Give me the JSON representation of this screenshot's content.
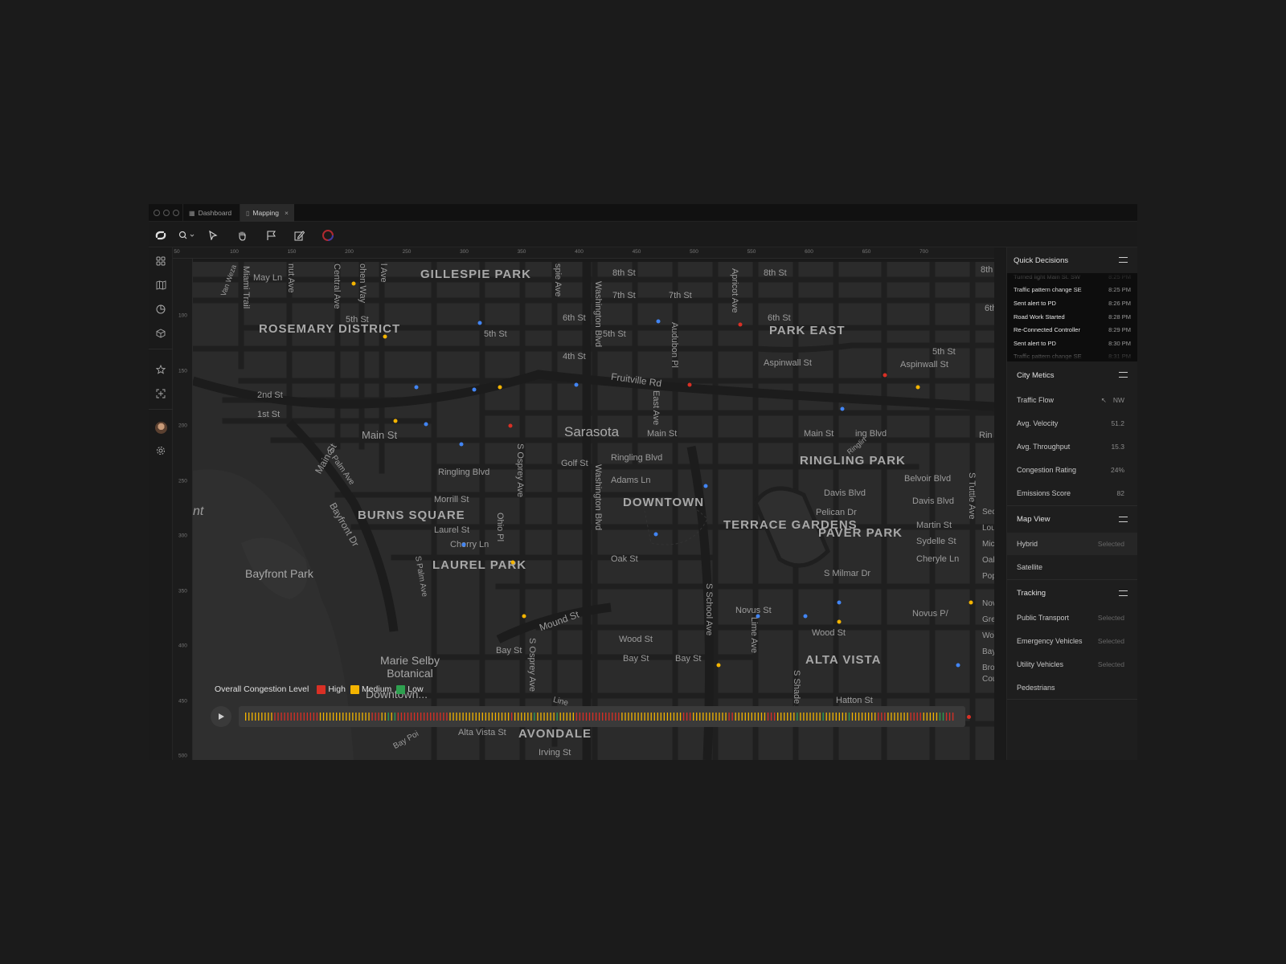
{
  "tabs": [
    {
      "label": "Dashboard",
      "icon": "grid-icon",
      "active": false
    },
    {
      "label": "Mapping",
      "icon": "map-icon",
      "active": true,
      "closable": true
    }
  ],
  "toolbar": {
    "tools": [
      "zoom-icon",
      "pointer-icon",
      "hand-icon",
      "flag-icon",
      "pencil-icon",
      "color-picker-icon"
    ]
  },
  "leftnav": {
    "items": [
      "apps-icon",
      "map-icon",
      "chart-icon",
      "cube-icon",
      "star-icon",
      "layout-icon",
      "avatar",
      "gear-icon"
    ]
  },
  "ruler": {
    "top": [
      "50",
      "100",
      "150",
      "200",
      "250",
      "300",
      "350",
      "400",
      "450",
      "500",
      "550",
      "600",
      "650",
      "700"
    ],
    "left": [
      "100",
      "150",
      "200",
      "250",
      "300",
      "350",
      "400",
      "450",
      "500"
    ]
  },
  "map": {
    "districts": {
      "gillespie": "GILLESPIE PARK",
      "rosemary": "ROSEMARY DISTRICT",
      "park_east": "PARK EAST",
      "ringling_park": "RINGLING PARK",
      "burns": "BURNS SQUARE",
      "downtown": "DOWNTOWN",
      "terrace": "TERRACE GARDENS",
      "paver": "PAVER PARK",
      "laurel": "LAUREL PARK",
      "alta_vista": "ALTA VISTA",
      "avondale": "AVONDALE"
    },
    "places": {
      "sarasota": "Sarasota",
      "bayfront": "Bayfront Park",
      "selby": "Marie Selby Botanical",
      "downtown_sub": "Downtown...",
      "gulf": "nt"
    },
    "streets": {
      "may_ln": "May Ln",
      "miami_trail": "Miami Trail",
      "nut_ave": "nut Ave",
      "central_ave": "Central Ave",
      "cohen_way": "ohen Way",
      "ol_ave": "l Ave",
      "van_wezel": "Van Weza",
      "fifth_st_a": "5th St",
      "fifth_st_b": "5th St",
      "fifth_st_c": "5th St",
      "fifth_st_d": "5th St",
      "second_st": "2nd St",
      "first_st": "1st St",
      "main_st_a": "Main St",
      "main_st_b": "Main St",
      "main_st_c": "Main St",
      "main_st_d": "Main St",
      "s_palm_ave": "S Palm Ave",
      "s_palm_ave_2": "S Palm Ave",
      "ringling_blvd_a": "Ringling Blvd",
      "ringling_blvd_b": "Ringling Blvd",
      "ringling_blvd_c": "ing Blvd",
      "ringling_d": "Ringlin",
      "morrill_st": "Morrill St",
      "laurel_st": "Laurel St",
      "cherry_ln": "Cherry Ln",
      "bayfront_dr": "Bayfront Dr",
      "ohio_pl": "Ohio Pl",
      "s_osprey_a": "S Osprey Ave",
      "s_osprey_b": "S Osprey Ave",
      "gillespie_ave": "spie Ave",
      "sixth_st_a": "6th St",
      "sixth_st_b": "6th St",
      "sixth_st_c": "6th",
      "fourth_st": "4th St",
      "eighth_st_a": "8th St",
      "eighth_st_b": "8th St",
      "eighth_st_c": "8th",
      "seventh_st_a": "7th St",
      "seventh_st_b": "7th St",
      "washington_a": "Washington Blvd",
      "washington_b": "Washington Blvd",
      "audubon": "Audubon Pl",
      "apricot": "Apricot Ave",
      "fruitville": "Fruitville Rd",
      "east_ave": "East Ave",
      "golf_st": "Golf St",
      "adams_ln": "Adams Ln",
      "oak_st": "Oak St",
      "mound_st": "Mound St",
      "wood_st_a": "Wood St",
      "wood_st_b": "Wood St",
      "bay_st_a": "Bay St",
      "bay_st_b": "Bay St",
      "bay_st_c": "Bay St",
      "novus_st_a": "Novus St",
      "novus_st_b": "Novus P/",
      "s_school": "S School Ave",
      "lime_ave": "Lime Ave",
      "aspinwall_a": "Aspinwall St",
      "aspinwall_b": "Aspinwall St",
      "belvoir": "Belvoir Blvd",
      "davis_a": "Davis Blvd",
      "davis_b": "Davis Blvd",
      "pelican": "Pelican Dr",
      "martin": "Martin St",
      "sydelle": "Sydelle St",
      "cheryle": "Cheryle Ln",
      "s_milmar": "S Milmar Dr",
      "s_tuttle": "S Tuttle Ave",
      "hatton": "Hatton St",
      "alta_vista_st": "Alta Vista St",
      "irving": "Irving St",
      "bay_point": "Bay Poi",
      "s_shade": "S Shade Ave",
      "line_st": "Line",
      "rin": "Rin",
      "sec": "Sec",
      "lou": "Lou",
      "mic": "Mic",
      "oak": "Oak",
      "pop": "Pop",
      "nov": "Nov",
      "gre": "Gre",
      "wo": "Wo",
      "bay": "Bay",
      "bro": "Bro",
      "cou": "Cou"
    },
    "dot_colors": {
      "high": "#d93025",
      "medium": "#f4b400",
      "low": "#4285f4"
    },
    "markers": [
      {
        "level": "medium",
        "lon": 110,
        "lat": 100
      },
      {
        "level": "medium",
        "lon": 137,
        "lat": 148
      },
      {
        "level": "low",
        "lon": 219,
        "lat": 136
      },
      {
        "level": "low",
        "lon": 373,
        "lat": 134
      },
      {
        "level": "high",
        "lon": 444,
        "lat": 137
      },
      {
        "level": "low",
        "lon": 164,
        "lat": 194
      },
      {
        "level": "low",
        "lon": 214,
        "lat": 196
      },
      {
        "level": "medium",
        "lon": 236,
        "lat": 194
      },
      {
        "level": "low",
        "lon": 302,
        "lat": 192
      },
      {
        "level": "high",
        "lon": 400,
        "lat": 192
      },
      {
        "level": "medium",
        "lon": 146,
        "lat": 225
      },
      {
        "level": "low",
        "lon": 172,
        "lat": 228
      },
      {
        "level": "high",
        "lon": 245,
        "lat": 229
      },
      {
        "level": "low",
        "lon": 203,
        "lat": 246
      },
      {
        "level": "high",
        "lon": 569,
        "lat": 183
      },
      {
        "level": "medium",
        "lon": 597,
        "lat": 194
      },
      {
        "level": "high",
        "lon": 713,
        "lat": 193
      },
      {
        "level": "low",
        "lon": 532,
        "lat": 214
      },
      {
        "level": "low",
        "lon": 414,
        "lat": 284
      },
      {
        "level": "low",
        "lon": 371,
        "lat": 328
      },
      {
        "level": "low",
        "lon": 205,
        "lat": 337
      },
      {
        "level": "medium",
        "lon": 247,
        "lat": 353
      },
      {
        "level": "high",
        "lon": 725,
        "lat": 339
      },
      {
        "level": "low",
        "lon": 529,
        "lat": 390
      },
      {
        "level": "medium",
        "lon": 643,
        "lat": 390
      },
      {
        "level": "low",
        "lon": 459,
        "lat": 402
      },
      {
        "level": "low",
        "lon": 500,
        "lat": 402
      },
      {
        "level": "medium",
        "lon": 529,
        "lat": 407
      },
      {
        "level": "medium",
        "lon": 257,
        "lat": 402
      },
      {
        "level": "medium",
        "lon": 425,
        "lat": 447
      },
      {
        "level": "low",
        "lon": 632,
        "lat": 447
      },
      {
        "level": "low",
        "lon": 287,
        "lat": 487
      },
      {
        "level": "medium",
        "lon": 400,
        "lat": 498
      }
    ]
  },
  "congestion": {
    "title": "Overall Congestion Level",
    "legend": [
      {
        "label": "High",
        "color": "#d93025"
      },
      {
        "label": "Medium",
        "color": "#f4b400"
      },
      {
        "label": "Low",
        "color": "#2ea04f"
      }
    ],
    "timeline_pattern": "MMMMMMMMMHHHHHHHHHHHHHHMMMMMMMMMMMMMMMMHHHMMLMLHHHHHHHHHHHHHHHHMMMMMMMMMMMMMMMMMMMHMMMMMMLMMMMMMLMMMMMHHHHHHHHHHHHHHMMMMMMMMMMMMMMMMMMMHHHMMMMMMMMMMMHHMMMMMMMMMMHHHMMMMMMLMMMMMMMLMMMMMMMLMMMMMMMMHHHMMMMMMMHHHHMMMMMLLHHH"
  },
  "quick_decisions": {
    "title": "Quick Decisions",
    "items": [
      {
        "label": "Turned light Main St. SW",
        "time": "8:25 PM"
      },
      {
        "label": "Traffic pattern change SE",
        "time": "8:25 PM"
      },
      {
        "label": "Sent alert to PD",
        "time": "8:26 PM"
      },
      {
        "label": "Road Work Started",
        "time": "8:28 PM"
      },
      {
        "label": "Re-Connected Controller",
        "time": "8:29 PM"
      },
      {
        "label": "Sent alert to PD",
        "time": "8:30 PM"
      },
      {
        "label": "Traffic pattern change SE",
        "time": "8:31 PM"
      }
    ]
  },
  "city_metrics": {
    "title": "City Metics",
    "items": [
      {
        "label": "Traffic Flow",
        "value": "NW",
        "arrow": "↖"
      },
      {
        "label": "Avg. Velocity",
        "value": "51.2"
      },
      {
        "label": "Avg. Throughput",
        "value": "15.3"
      },
      {
        "label": "Congestion Rating",
        "value": "24%"
      },
      {
        "label": "Emissions Score",
        "value": "82"
      }
    ]
  },
  "map_view": {
    "title": "Map View",
    "items": [
      {
        "label": "Hybrid",
        "state": "Selected"
      },
      {
        "label": "Satellite",
        "state": ""
      }
    ]
  },
  "tracking": {
    "title": "Tracking",
    "items": [
      {
        "label": "Public Transport",
        "state": "Selected"
      },
      {
        "label": "Emergency Vehicles",
        "state": "Selected"
      },
      {
        "label": "Utility Vehicles",
        "state": "Selected"
      },
      {
        "label": "Pedestrians",
        "state": ""
      }
    ]
  }
}
